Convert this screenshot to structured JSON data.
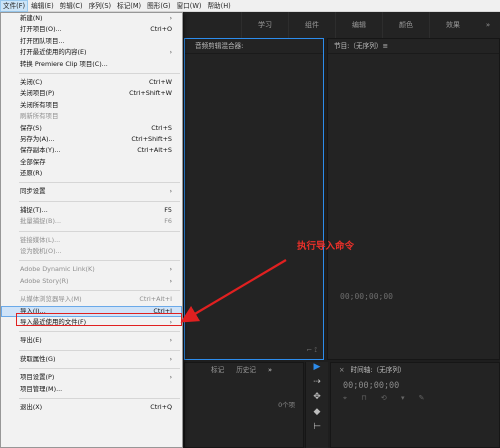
{
  "menubar": {
    "items": [
      "文件(F)",
      "编辑(E)",
      "剪辑(C)",
      "序列(S)",
      "标记(M)",
      "图形(G)",
      "窗口(W)",
      "帮助(H)"
    ]
  },
  "workspace": {
    "tabs": [
      "学习",
      "组件",
      "编辑",
      "颜色",
      "效果"
    ],
    "more": "»"
  },
  "panels": {
    "source_tab": "音频剪辑混合器:",
    "program_tab": "节目:（无序列）≡",
    "program_timecode": "00;00;00;00",
    "project_tabs": [
      "标记",
      "历史记"
    ],
    "project_more": "»",
    "project_count": "0个项",
    "timeline_tab": "时间轴:（无序列）",
    "timeline_timecode": "00;00;00;00",
    "tools": [
      "▶",
      "⇢",
      "✥",
      "◆",
      "⊢"
    ]
  },
  "file_menu": {
    "groups": [
      [
        {
          "label": "新建(N)",
          "shortcut": "",
          "submenu": true,
          "disabled": false
        },
        {
          "label": "打开项目(O)...",
          "shortcut": "Ctrl+O",
          "submenu": false,
          "disabled": false
        },
        {
          "label": "打开团队项目...",
          "shortcut": "",
          "submenu": false,
          "disabled": false
        },
        {
          "label": "打开最近使用的内容(E)",
          "shortcut": "",
          "submenu": true,
          "disabled": false
        },
        {
          "label": "转换 Premiere Clip 项目(C)...",
          "shortcut": "",
          "submenu": false,
          "disabled": false
        }
      ],
      [
        {
          "label": "关闭(C)",
          "shortcut": "Ctrl+W",
          "submenu": false,
          "disabled": false
        },
        {
          "label": "关闭项目(P)",
          "shortcut": "Ctrl+Shift+W",
          "submenu": false,
          "disabled": false
        },
        {
          "label": "关闭所有项目",
          "shortcut": "",
          "submenu": false,
          "disabled": false
        },
        {
          "label": "刷新所有项目",
          "shortcut": "",
          "submenu": false,
          "disabled": true
        },
        {
          "label": "保存(S)",
          "shortcut": "Ctrl+S",
          "submenu": false,
          "disabled": false
        },
        {
          "label": "另存为(A)...",
          "shortcut": "Ctrl+Shift+S",
          "submenu": false,
          "disabled": false
        },
        {
          "label": "保存副本(Y)...",
          "shortcut": "Ctrl+Alt+S",
          "submenu": false,
          "disabled": false
        },
        {
          "label": "全部保存",
          "shortcut": "",
          "submenu": false,
          "disabled": false
        },
        {
          "label": "还原(R)",
          "shortcut": "",
          "submenu": false,
          "disabled": false
        }
      ],
      [
        {
          "label": "同步设置",
          "shortcut": "",
          "submenu": true,
          "disabled": false
        }
      ],
      [
        {
          "label": "捕捉(T)...",
          "shortcut": "F5",
          "submenu": false,
          "disabled": false
        },
        {
          "label": "批量捕捉(B)...",
          "shortcut": "F6",
          "submenu": false,
          "disabled": true
        }
      ],
      [
        {
          "label": "链接媒体(L)...",
          "shortcut": "",
          "submenu": false,
          "disabled": true
        },
        {
          "label": "设为脱机(O)...",
          "shortcut": "",
          "submenu": false,
          "disabled": true
        }
      ],
      [
        {
          "label": "Adobe Dynamic Link(K)",
          "shortcut": "",
          "submenu": true,
          "disabled": true
        },
        {
          "label": "Adobe Story(R)",
          "shortcut": "",
          "submenu": true,
          "disabled": true
        }
      ],
      [
        {
          "label": "从媒体浏览器导入(M)",
          "shortcut": "Ctrl+Alt+I",
          "submenu": false,
          "disabled": true
        },
        {
          "label": "导入(I)...",
          "shortcut": "Ctrl+I",
          "submenu": false,
          "disabled": false,
          "highlight": true
        },
        {
          "label": "导入最近使用的文件(F)",
          "shortcut": "",
          "submenu": true,
          "disabled": false
        }
      ],
      [
        {
          "label": "导出(E)",
          "shortcut": "",
          "submenu": true,
          "disabled": false
        }
      ],
      [
        {
          "label": "获取属性(G)",
          "shortcut": "",
          "submenu": true,
          "disabled": false
        }
      ],
      [
        {
          "label": "项目设置(P)",
          "shortcut": "",
          "submenu": true,
          "disabled": false
        },
        {
          "label": "项目管理(M)...",
          "shortcut": "",
          "submenu": false,
          "disabled": false
        }
      ],
      [
        {
          "label": "退出(X)",
          "shortcut": "Ctrl+Q",
          "submenu": false,
          "disabled": false
        }
      ]
    ]
  },
  "annotation": {
    "text": "执行导入命令",
    "color": "#e8302a"
  },
  "colors": {
    "accent": "#2d8ceb",
    "menu_highlight": "#cfe3f8"
  }
}
